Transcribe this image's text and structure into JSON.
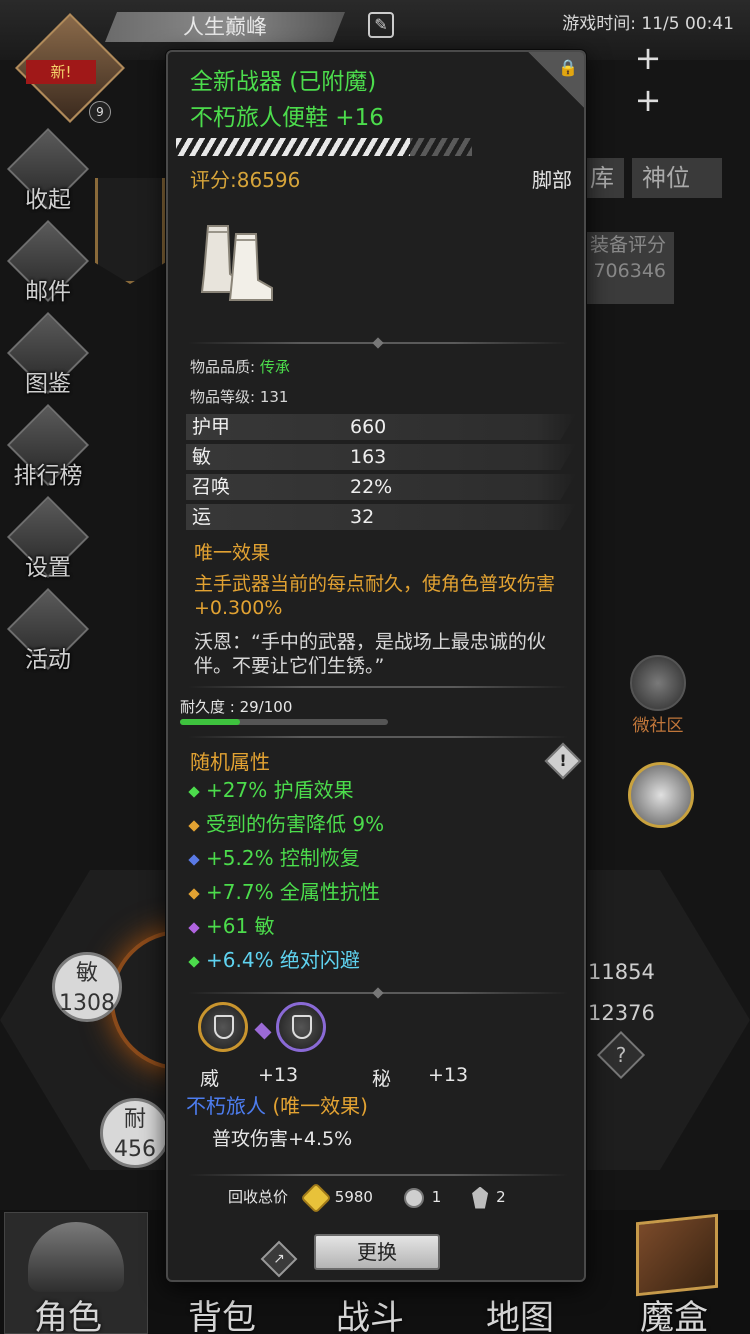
{
  "background": {
    "player_title": "人生巅峰",
    "game_time": "游戏时间: 11/5 00:41",
    "new_badge": "新!",
    "level_badge": "9",
    "side_menu": [
      "收起",
      "邮件",
      "图鉴",
      "排行榜",
      "设置",
      "活动"
    ],
    "tabs": [
      "库",
      "神位"
    ],
    "equip_rating_label": "装备评分",
    "equip_rating_value": "706346",
    "community_label": "微社区",
    "stat_bubbles": [
      {
        "label": "敏",
        "value": "1308"
      },
      {
        "label": "耐",
        "value": "456"
      }
    ],
    "side_numbers": [
      "11854",
      "12376"
    ],
    "help_glyph": "?",
    "bottom_nav": [
      "角色",
      "背包",
      "战斗",
      "地图",
      "魔盒"
    ]
  },
  "tooltip": {
    "header_line1": "全新战器 (已附魔)",
    "header_line2": "不朽旅人便鞋 +16",
    "lock_glyph": "🔒",
    "score": "评分:86596",
    "slot": "脚部",
    "quality_label": "物品品质: ",
    "quality_value": "传承",
    "level_text": "物品等级: 131",
    "stats": [
      {
        "name": "护甲",
        "value": "660"
      },
      {
        "name": "敏",
        "value": "163"
      },
      {
        "name": "召唤",
        "value": "22%"
      },
      {
        "name": "运",
        "value": "32"
      }
    ],
    "unique_title": "唯一效果",
    "unique_desc": "主手武器当前的每点耐久，使角色普攻伤害+0.300%",
    "lore": "沃恩：“手中的武器，是战场上最忠诚的伙伴。不要让它们生锈。”",
    "durability_label": "耐久度 : 29/100",
    "durability_fraction": 0.29,
    "random_title": "随机属性",
    "warn_glyph": "!",
    "random_attrs": [
      {
        "text": "+27% 护盾效果",
        "color": "#4cdc4c",
        "dot": "#4cdc4c"
      },
      {
        "text": "受到的伤害降低 9%",
        "color": "#4cdc4c",
        "dot": "#e2a232"
      },
      {
        "text": "+5.2% 控制恢复",
        "color": "#4cdc4c",
        "dot": "#5a7ae6"
      },
      {
        "text": "+7.7% 全属性抗性",
        "color": "#4cdc4c",
        "dot": "#e2a232"
      },
      {
        "text": "+61 敏",
        "color": "#4cdc4c",
        "dot": "#b064e0"
      },
      {
        "text": "+6.4% 绝对闪避",
        "color": "#5fd3f0",
        "dot": "#4cdc4c"
      }
    ],
    "sockets": [
      {
        "name": "威",
        "value": "+13"
      },
      {
        "name": "秘",
        "value": "+13"
      }
    ],
    "set_name": "不朽旅人",
    "set_suffix": "(唯一效果)",
    "set_bonus": "普攻伤害+4.5%",
    "recycle_label": "回收总价",
    "recycle_gold": "5980",
    "recycle_crystal": "1",
    "recycle_shard": "2",
    "share_glyph": "↗",
    "replace_button": "更换"
  }
}
